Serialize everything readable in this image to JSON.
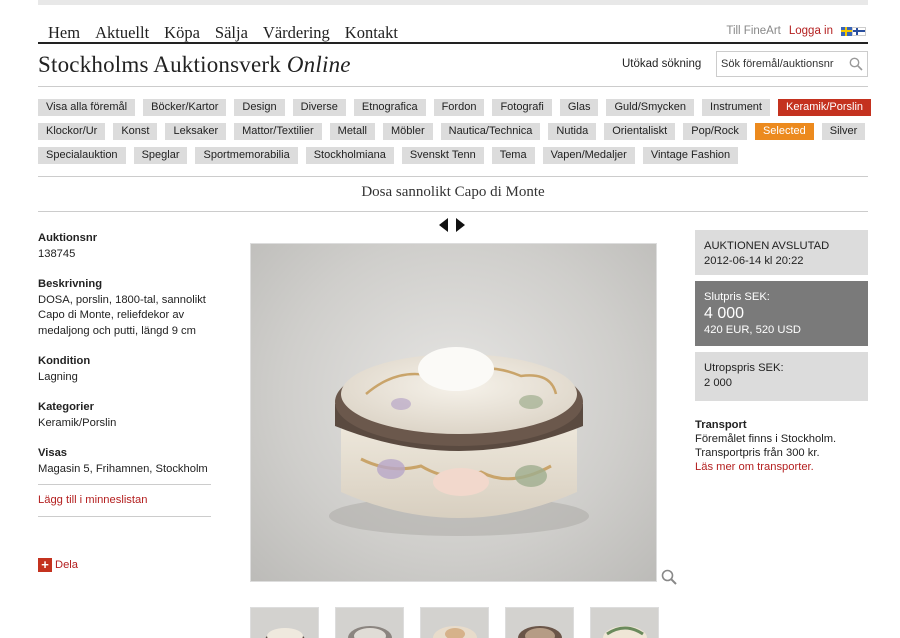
{
  "nav": {
    "items": [
      "Hem",
      "Aktuellt",
      "Köpa",
      "Sälja",
      "Värdering",
      "Kontakt"
    ],
    "fineart": "Till FineArt",
    "login": "Logga in"
  },
  "header": {
    "logo_main": "Stockholms Auktionsverk",
    "logo_italic": "Online",
    "advanced_search": "Utökad sökning",
    "search_placeholder": "Sök föremål/auktionsnr"
  },
  "categories": {
    "row1": [
      "Visa alla föremål",
      "Böcker/Kartor",
      "Design",
      "Diverse",
      "Etnografica",
      "Fordon",
      "Fotografi",
      "Glas",
      "Guld/Smycken",
      "Instrument",
      "Keramik/Porslin"
    ],
    "row2": [
      "Klockor/Ur",
      "Konst",
      "Leksaker",
      "Mattor/Textilier",
      "Metall",
      "Möbler",
      "Nautica/Technica",
      "Nutida",
      "Orientaliskt",
      "Pop/Rock",
      "Selected",
      "Silver"
    ],
    "row3": [
      "Specialauktion",
      "Speglar",
      "Sportmemorabilia",
      "Stockholmiana",
      "Svenskt Tenn",
      "Tema",
      "Vapen/Medaljer",
      "Vintage Fashion"
    ],
    "active": "Keramik/Porslin",
    "highlight": "Selected",
    "active_color": "#c4321f",
    "highlight_color": "#ec8a1e"
  },
  "item": {
    "title": "Dosa sannolikt Capo di Monte",
    "auktionsnr_label": "Auktionsnr",
    "auktionsnr": "138745",
    "beskrivning_label": "Beskrivning",
    "beskrivning": "DOSA, porslin, 1800-tal, sannolikt Capo di Monte, reliefdekor av medaljong och putti, längd 9 cm",
    "kondition_label": "Kondition",
    "kondition": "Lagning",
    "kategorier_label": "Kategorier",
    "kategorier": "Keramik/Porslin",
    "visas_label": "Visas",
    "visas": "Magasin 5, Frihamnen, Stockholm",
    "watchlist": "Lägg till i minneslistan",
    "share": "Dela"
  },
  "auction": {
    "status": "AUKTIONEN AVSLUTAD",
    "date": "2012-06-14 kl 20:22",
    "final_label": "Slutpris SEK:",
    "final_price": "4 000",
    "final_other": "420 EUR, 520 USD",
    "start_label": "Utropspris SEK:",
    "start_price": "2 000",
    "transport_label": "Transport",
    "transport_line1": "Föremålet finns i Stockholm.",
    "transport_line2": "Transportpris från 300 kr.",
    "transport_link": "Läs mer om transporter."
  },
  "icons": {
    "search": "search-icon",
    "zoom": "magnifier-icon",
    "prev": "arrow-left-icon",
    "next": "arrow-right-icon",
    "share": "plus-icon"
  }
}
